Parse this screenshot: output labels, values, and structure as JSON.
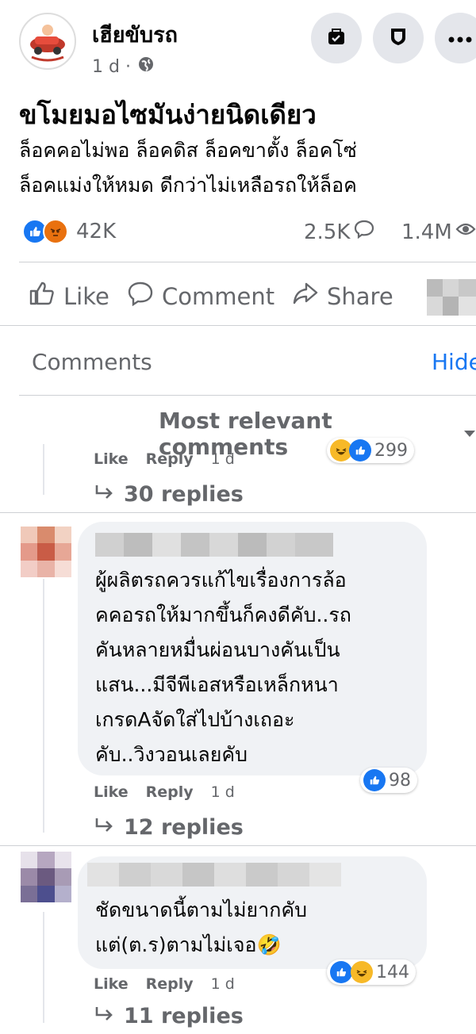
{
  "post": {
    "page_name": "เฮียขับรถ",
    "time": "1 d ·",
    "headline": "ขโมยมอไซมันง่ายนิดเดียว",
    "body_lines": [
      "ล็อคคอไม่พอ ล็อคดิส ล็อคขาตั้ง ล็อคโซ่",
      "ล็อคแม่งให้หมด ดีกว่าไม่เหลือรถให้ล็อค"
    ],
    "reactions_count": "42K",
    "comments_count": "2.5K",
    "views_count": "1.4M"
  },
  "actions": {
    "like": "Like",
    "comment": "Comment",
    "share": "Share"
  },
  "comments_header": {
    "title": "Comments",
    "hide": "Hide",
    "sort": "Most relevant comments"
  },
  "comments": [
    {
      "like": "Like",
      "reply": "Reply",
      "time": "1 d",
      "reactions": "299",
      "replies": "30 replies"
    },
    {
      "text_lines": [
        "ผู้ผลิตรถควรแก้ไขเรื่องการล้อ",
        "คคอรถให้มากขึ้นก็คงดีคับ..รถ",
        "คันหลายหมื่นผ่อนบางคันเป็น",
        "แสน...มีจีพีเอสหรือเหล็กหนา",
        "เกรดAจัดใส่ไปบ้างเถอะ",
        "คับ..วิงวอนเลยคับ"
      ],
      "like": "Like",
      "reply": "Reply",
      "time": "1 d",
      "reactions": "98",
      "replies": "12 replies"
    },
    {
      "text_lines": [
        "ชัดขนาดนี้ตามไม่ยากคับ",
        "แต่(ต.ร)ตามไม่เจอ🤣"
      ],
      "like": "Like",
      "reply": "Reply",
      "time": "1 d",
      "reactions": "144",
      "replies": "11 replies"
    }
  ],
  "colors": {
    "accent": "#1877f2",
    "secondary_text": "#65676b",
    "bubble": "#f0f2f5"
  }
}
